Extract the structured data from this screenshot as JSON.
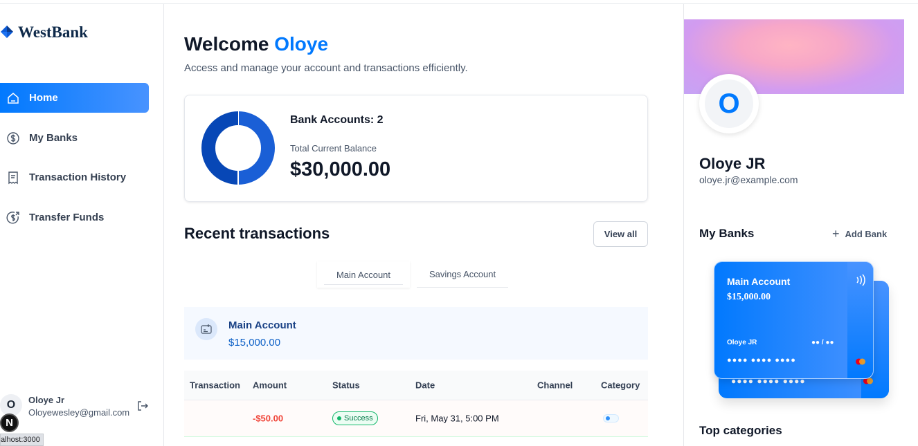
{
  "app": {
    "brand": "WestBank"
  },
  "sidebar": {
    "items": [
      {
        "label": "Home",
        "icon": "home-icon",
        "active": true
      },
      {
        "label": "My Banks",
        "icon": "dollar-circle-icon",
        "active": false
      },
      {
        "label": "Transaction History",
        "icon": "receipt-icon",
        "active": false
      },
      {
        "label": "Transfer Funds",
        "icon": "money-send-icon",
        "active": false
      }
    ],
    "footer": {
      "avatar_initial": "O",
      "name": "Oloye Jr",
      "email": "Oloyewesley@gmail.com"
    }
  },
  "browser": {
    "badge": "N",
    "status_url": "alhost:3000"
  },
  "header": {
    "welcome_prefix": "Welcome",
    "welcome_name": "Oloye",
    "subtitle": "Access and manage your account and transactions efficiently."
  },
  "balance": {
    "accounts_label": "Bank Accounts: 2",
    "total_label": "Total Current Balance",
    "total_value": "$30,000.00",
    "donut": {
      "slices": [
        {
          "name": "Main Account",
          "value": 15000,
          "color": "#1a5fd6"
        },
        {
          "name": "Savings Account",
          "value": 15000,
          "color": "#0747b6"
        }
      ]
    }
  },
  "recent": {
    "title": "Recent transactions",
    "view_all": "View all",
    "tabs": [
      "Main Account",
      "Savings Account"
    ],
    "account": {
      "name": "Main Account",
      "balance": "$15,000.00"
    },
    "columns": [
      "Transaction",
      "Amount",
      "Status",
      "Date",
      "Channel",
      "Category"
    ],
    "rows": [
      {
        "transaction": "",
        "amount": "-$50.00",
        "status": "Success",
        "date": "Fri, May 31, 5:00 PM",
        "channel": "",
        "category": ""
      }
    ]
  },
  "profile": {
    "avatar_initial": "O",
    "name": "Oloye JR",
    "email": "oloye.jr@example.com"
  },
  "banks": {
    "title": "My Banks",
    "add_label": "Add Bank",
    "cards": [
      {
        "name": "Main Account",
        "balance": "$15,000.00",
        "holder": "Oloye JR",
        "expiry": "●● / ●●",
        "number": "●●●● ●●●● ●●●●"
      },
      {
        "number": "●●●● ●●●● ●●●●"
      }
    ]
  },
  "top_categories": {
    "title": "Top categories"
  },
  "colors": {
    "accent": "#0179fe",
    "success": "#12b76a",
    "danger": "#f04438"
  }
}
